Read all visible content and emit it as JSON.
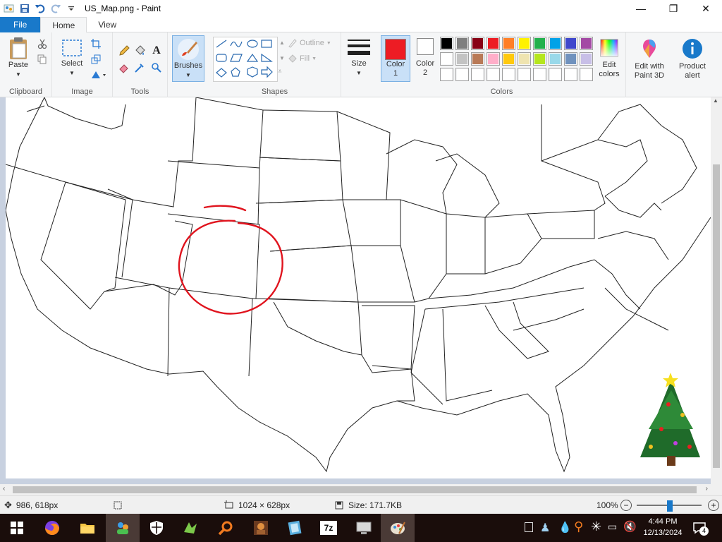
{
  "window": {
    "title": "US_Map.png - Paint",
    "minimize": "—",
    "maximize": "❐",
    "close": "✕"
  },
  "tabs": [
    {
      "label": "File"
    },
    {
      "label": "Home"
    },
    {
      "label": "View"
    }
  ],
  "ribbon": {
    "clipboard": {
      "label": "Clipboard",
      "paste": "Paste"
    },
    "image": {
      "label": "Image",
      "select": "Select"
    },
    "tools": {
      "label": "Tools",
      "text_glyph": "A"
    },
    "brushes": {
      "label": "Brushes"
    },
    "shapes": {
      "label": "Shapes",
      "outline": "Outline",
      "fill": "Fill"
    },
    "size": {
      "label": "Size"
    },
    "color1": {
      "label1": "Color",
      "label2": "1",
      "value": "#ed1c24"
    },
    "color2": {
      "label1": "Color",
      "label2": "2",
      "value": "#ffffff"
    },
    "colors": {
      "label": "Colors",
      "row1": [
        "#000000",
        "#7f7f7f",
        "#880015",
        "#ed1c24",
        "#ff7f27",
        "#fff200",
        "#22b14c",
        "#00a2e8",
        "#3f48cc",
        "#a349a4"
      ],
      "row2": [
        "#ffffff",
        "#c3c3c3",
        "#b97a57",
        "#ffaec9",
        "#ffc90e",
        "#efe4b0",
        "#b5e61d",
        "#99d9ea",
        "#7092be",
        "#c8bfe7"
      ],
      "row3": [
        "#ffffff",
        "#ffffff",
        "#ffffff",
        "#ffffff",
        "#ffffff",
        "#ffffff",
        "#ffffff",
        "#ffffff",
        "#ffffff",
        "#ffffff"
      ]
    },
    "edit_colors": {
      "line1": "Edit",
      "line2": "colors"
    },
    "paint3d": {
      "line1": "Edit with",
      "line2": "Paint 3D"
    },
    "product_alert": {
      "line1": "Product",
      "line2": "alert"
    }
  },
  "status": {
    "cursor_pos": "986, 618px",
    "image_size": "1024 × 628px",
    "file_size": "Size: 171.7KB",
    "zoom": "100%"
  },
  "taskbar": {
    "time": "4:44 PM",
    "date": "12/13/2024",
    "notification_count": "4",
    "seven_zip": "7z"
  }
}
